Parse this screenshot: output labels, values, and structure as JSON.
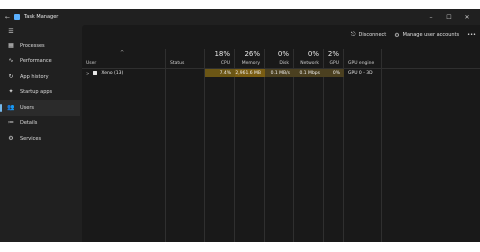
{
  "app": {
    "title": "Task Manager"
  },
  "window_controls": {
    "minimize": "–",
    "maximize": "☐",
    "close": "✕"
  },
  "sidebar": {
    "menu_icon": "☰",
    "items": [
      {
        "label": "Processes",
        "icon": "▦"
      },
      {
        "label": "Performance",
        "icon": "∿"
      },
      {
        "label": "App history",
        "icon": "↻"
      },
      {
        "label": "Startup apps",
        "icon": "✦"
      },
      {
        "label": "Users",
        "icon": "👥",
        "active": true
      },
      {
        "label": "Details",
        "icon": "≔"
      },
      {
        "label": "Services",
        "icon": "⚙"
      }
    ]
  },
  "toolbar": {
    "disconnect_label": "Disconnect",
    "disconnect_icon": "⎋",
    "manage_label": "Manage user accounts",
    "manage_icon": "⚙",
    "more_label": "•••"
  },
  "table": {
    "sort_arrow": "^",
    "columns": {
      "user": {
        "name": "User"
      },
      "status": {
        "name": "Status"
      },
      "cpu": {
        "name": "CPU",
        "percent": "18%"
      },
      "memory": {
        "name": "Memory",
        "percent": "26%"
      },
      "disk": {
        "name": "Disk",
        "percent": "0%"
      },
      "network": {
        "name": "Network",
        "percent": "0%"
      },
      "gpu": {
        "name": "GPU",
        "percent": "2%"
      },
      "gpu_engine": {
        "name": "GPU engine"
      }
    },
    "rows": [
      {
        "user": "Xeno (13)",
        "expander": ">",
        "status": "",
        "cpu": "7.4%",
        "memory": "2,961.6 MB",
        "disk": "0.1 MB/s",
        "network": "0.1 Mbps",
        "gpu": "0%",
        "gpu_engine": "GPU 0 - 3D"
      }
    ]
  },
  "colors": {
    "heat_cpu": "#6b5615",
    "heat_memory": "#7a5d12",
    "heat_light": "#4b4020",
    "accent": "#76b9ed"
  }
}
